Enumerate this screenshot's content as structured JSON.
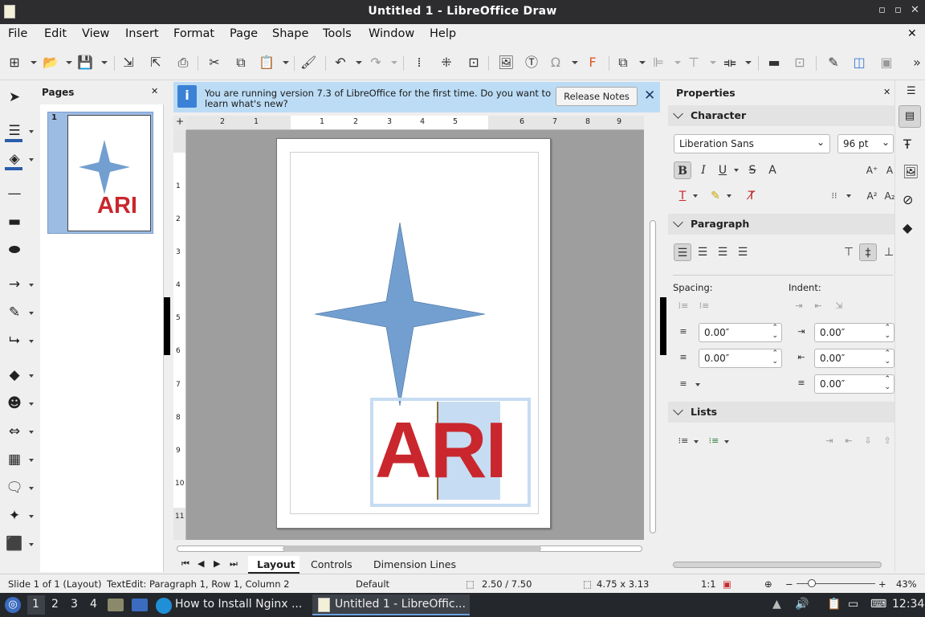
{
  "window": {
    "title": "Untitled 1 - LibreOffice Draw",
    "controls": [
      "minimize-icon",
      "maximize-icon",
      "close-icon"
    ]
  },
  "menu": [
    "File",
    "Edit",
    "View",
    "Insert",
    "Format",
    "Page",
    "Shape",
    "Tools",
    "Window",
    "Help"
  ],
  "infobar": {
    "message_line1": "You are running version 7.3 of LibreOffice for the first time. Do you want to",
    "message_line2": "learn what's new?",
    "button": "Release Notes"
  },
  "pages_panel": {
    "title": "Pages",
    "page_number": "1",
    "thumbnail_text": "ARI"
  },
  "ruler": {
    "h_ticks": [
      "2",
      "1",
      "1",
      "2",
      "3",
      "4",
      "5",
      "6",
      "7",
      "8",
      "9",
      "10"
    ],
    "v_ticks": [
      "1",
      "2",
      "3",
      "4",
      "5",
      "6",
      "7",
      "8",
      "9",
      "10",
      "11"
    ]
  },
  "document": {
    "text": "ARI",
    "text_color": "#c9272d",
    "selection_color": "#c6dcf2",
    "shape": "four-point-star",
    "shape_color": "#729fcf"
  },
  "view_tabs": [
    "Layout",
    "Controls",
    "Dimension Lines"
  ],
  "properties": {
    "title": "Properties",
    "character": {
      "title": "Character",
      "font_name": "Liberation Sans",
      "font_size": "96 pt"
    },
    "paragraph": {
      "title": "Paragraph",
      "spacing_label": "Spacing:",
      "indent_label": "Indent:",
      "above": "0.00″",
      "below": "0.00″",
      "before_text": "0.00″",
      "after_text": "0.00″",
      "first_line": "0.00″"
    },
    "lists": {
      "title": "Lists"
    }
  },
  "status": {
    "slide": "Slide 1 of 1 (Layout)",
    "text_edit": "TextEdit: Paragraph 1, Row 1, Column 2",
    "layout_name": "Default",
    "position": "2.50 / 7.50",
    "size": "4.75 x 3.13",
    "scale": "1:1",
    "zoom": "43%"
  },
  "taskbar": {
    "workspaces": [
      "1",
      "2",
      "3",
      "4"
    ],
    "apps": [
      {
        "label": "How to Install Nginx ...",
        "icon": "edge-browser-icon"
      },
      {
        "label": "Untitled 1 - LibreOffic...",
        "icon": "libreoffice-draw-icon"
      }
    ],
    "clock": "12:34"
  }
}
